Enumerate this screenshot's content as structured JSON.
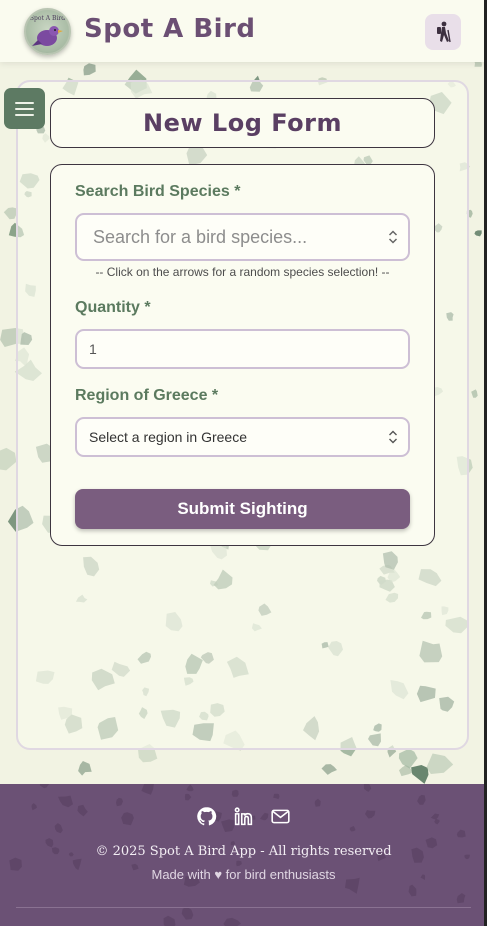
{
  "header": {
    "app_title": "Spot A Bird",
    "logo_text": "Spot A Bird",
    "hiker_icon": "hiker-icon"
  },
  "menu": {
    "icon": "hamburger-icon"
  },
  "form": {
    "title": "New Log Form",
    "species_label": "Search Bird Species *",
    "species_placeholder": "Search for a bird species...",
    "species_hint": "-- Click on the arrows for a random species selection! --",
    "quantity_label": "Quantity *",
    "quantity_value": "1",
    "region_label": "Region of Greece *",
    "region_value": "Select a region in Greece",
    "submit_label": "Submit Sighting"
  },
  "footer": {
    "icons": [
      "github-icon",
      "linkedin-icon",
      "mail-icon"
    ],
    "copyright": "© 2025 Spot A Bird App - All rights reserved",
    "made_with": "Made with ♥ for bird enthusiasts"
  },
  "colors": {
    "brand_purple": "#6b5175",
    "button_purple": "#7a5d7f",
    "label_green": "#5b7a5f",
    "menu_green": "#5d7a63",
    "background": "#f7f8ec"
  }
}
